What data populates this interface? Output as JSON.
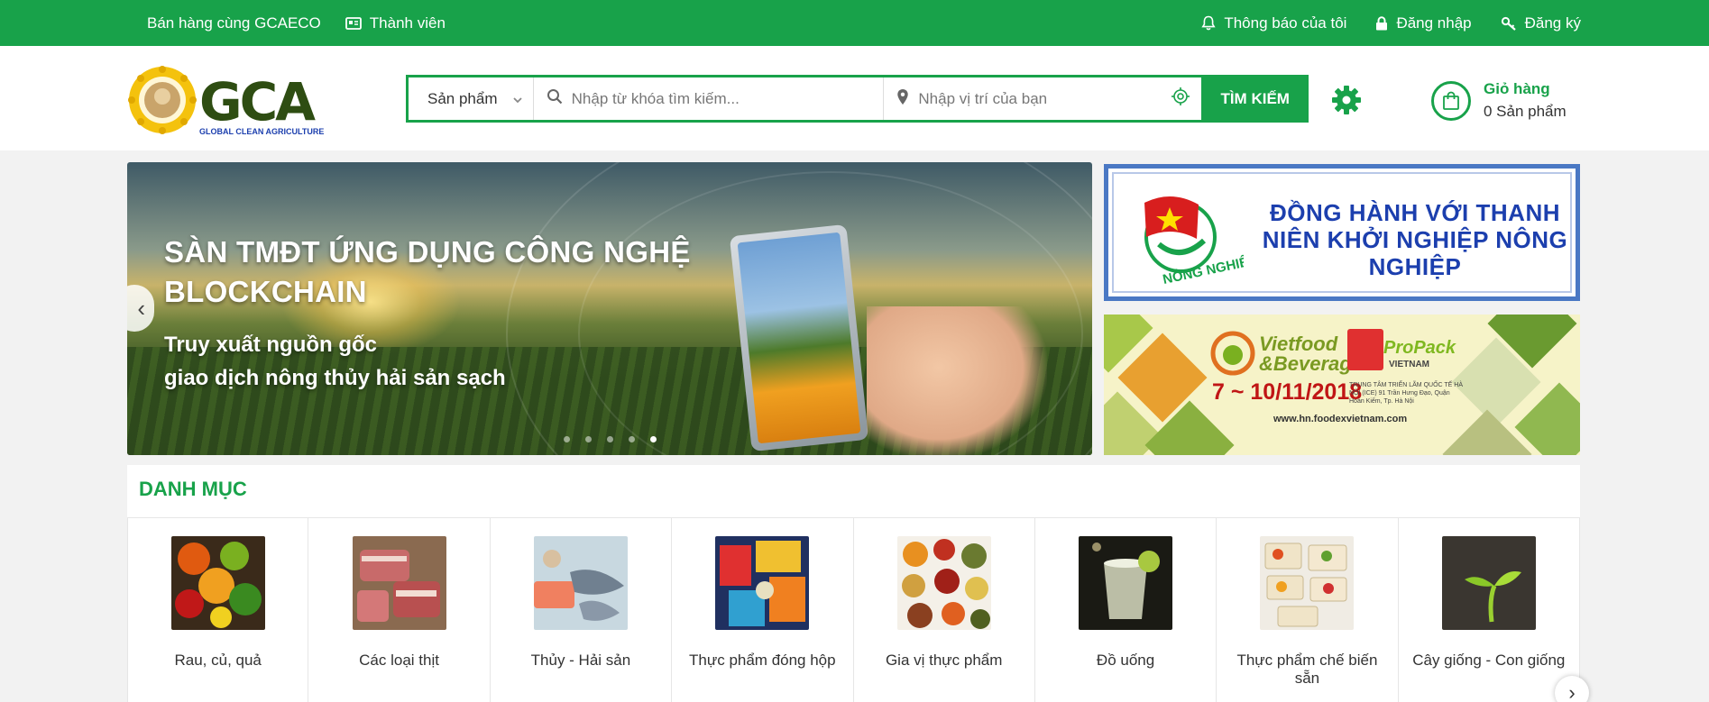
{
  "topbar": {
    "sell": "Bán hàng cùng GCAECO",
    "member": "Thành viên",
    "notifications": "Thông báo của tôi",
    "login": "Đăng nhập",
    "register": "Đăng ký"
  },
  "header": {
    "logo_text": "GCA",
    "logo_subtitle": "GLOBAL CLEAN AGRICULTURE",
    "search": {
      "category": "Sản phẩm",
      "keyword_placeholder": "Nhập từ khóa tìm kiếm...",
      "location_placeholder": "Nhập vị trí của bạn",
      "button": "TÌM KIẾM"
    },
    "cart": {
      "label": "Giỏ hàng",
      "count": "0 Sản phẩm"
    }
  },
  "hero": {
    "title": "SÀN TMĐT ỨNG DỤNG CÔNG NGHỆ BLOCKCHAIN",
    "subtitle_line1": "Truy xuất nguồn gốc",
    "subtitle_line2": "giao dịch nông thủy hải sản sạch",
    "prev": "‹",
    "slides": 5,
    "active_slide": 5
  },
  "side_banner_1": {
    "text": "ĐỒNG HÀNH VỚI THANH NIÊN KHỞI NGHIỆP NÔNG NGHIỆP",
    "emblem_text": "NÔNG NGHIỆP"
  },
  "side_banner_2": {
    "vietfood": "Vietfood &Beverage",
    "propack": "ProPack",
    "propack_sub": "VIETNAM",
    "date": "7 ~ 10/11/2018",
    "venue": "TRUNG TÂM TRIỂN LÃM QUỐC TẾ HÀ NỘI (ICE) 91 Trần Hưng Đạo, Quận Hoàn Kiếm, Tp. Hà Nội",
    "url": "www.hn.foodexvietnam.com"
  },
  "categories": {
    "title": "DANH MỤC",
    "next": "›",
    "items": [
      {
        "label": "Rau, củ, quả"
      },
      {
        "label": "Các loại thịt"
      },
      {
        "label": "Thủy - Hải sản"
      },
      {
        "label": "Thực phẩm đóng hộp"
      },
      {
        "label": "Gia vị thực phẩm"
      },
      {
        "label": "Đồ uống"
      },
      {
        "label": "Thực phẩm chế biến sẵn"
      },
      {
        "label": "Cây giống - Con giống"
      }
    ]
  },
  "colors": {
    "brand_green": "#18a24a",
    "banner_blue": "#1c3fae"
  }
}
